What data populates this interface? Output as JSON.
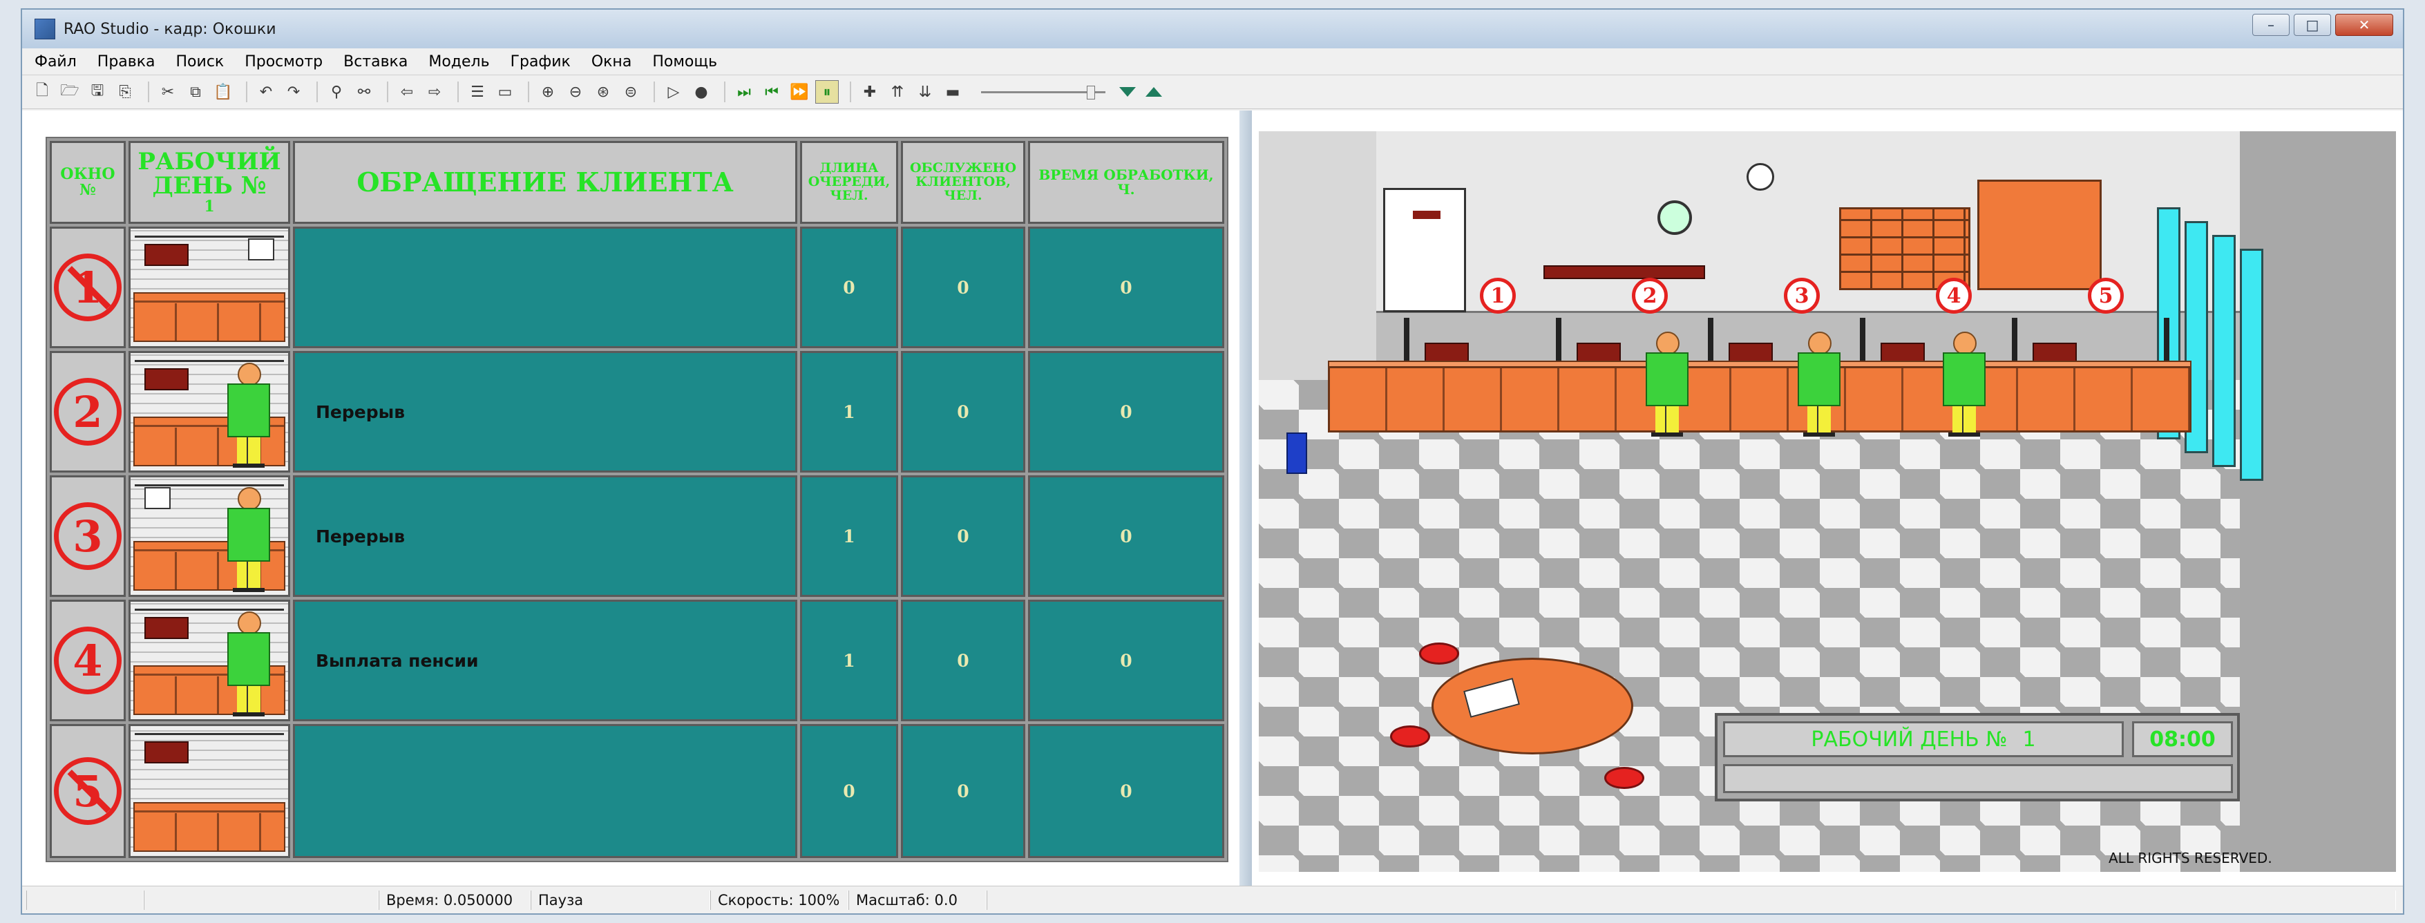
{
  "window": {
    "title": "RAO Studio - кадр: Окошки",
    "buttons": {
      "minimize": "–",
      "maximize": "□",
      "close": "✕"
    }
  },
  "menu": [
    "Файл",
    "Правка",
    "Поиск",
    "Просмотр",
    "Вставка",
    "Модель",
    "График",
    "Окна",
    "Помощь"
  ],
  "toolbar": {
    "icons": [
      "new-file-icon",
      "open-icon",
      "save-icon",
      "save-all-icon",
      "cut-icon",
      "copy-icon",
      "paste-icon",
      "undo-icon",
      "redo-icon",
      "find-icon",
      "replace-icon",
      "back-icon",
      "forward-icon",
      "list-icon",
      "report-icon",
      "zoom-in-icon",
      "zoom-out-icon",
      "zoom-fit-icon",
      "zoom-auto-icon",
      "run-icon",
      "record-icon",
      "step-icon",
      "step-back-icon",
      "fast-forward-icon",
      "pause-icon",
      "plus-icon",
      "speed-up-icon",
      "speed-down-icon",
      "minus-icon",
      "speed-slider",
      "arrow-down-icon",
      "arrow-up-icon"
    ],
    "speed_fraction": 0.9
  },
  "table": {
    "headers": {
      "window_no": "ОКНО №",
      "workday": "РАБОЧИЙ ДЕНЬ №",
      "workday_value": "1",
      "request": "ОБРАЩЕНИЕ КЛИЕНТА",
      "queue": "ДЛИНА ОЧЕРЕДИ, ЧЕЛ.",
      "served": "ОБСЛУЖЕНО КЛИЕНТОВ, ЧЕЛ.",
      "time": "ВРЕМЯ ОБРАБОТКИ, Ч."
    },
    "rows": [
      {
        "number": "1",
        "closed": true,
        "client_present": false,
        "request": "",
        "queue": "0",
        "served": "0",
        "time": "0"
      },
      {
        "number": "2",
        "closed": false,
        "client_present": true,
        "request": "Перерыв",
        "queue": "1",
        "served": "0",
        "time": "0"
      },
      {
        "number": "3",
        "closed": false,
        "client_present": true,
        "request": "Перерыв",
        "queue": "1",
        "served": "0",
        "time": "0"
      },
      {
        "number": "4",
        "closed": false,
        "client_present": true,
        "request": "Выплата пенсии",
        "queue": "1",
        "served": "0",
        "time": "0"
      },
      {
        "number": "5",
        "closed": true,
        "client_present": false,
        "request": "",
        "queue": "0",
        "served": "0",
        "time": "0"
      }
    ]
  },
  "scene": {
    "window_numbers": [
      "1",
      "2",
      "3",
      "4",
      "5"
    ],
    "panel": {
      "workday_label": "РАБОЧИЙ ДЕНЬ №",
      "workday_value": "1",
      "time": "08:00"
    },
    "copyright": "ALL RIGHTS RESERVED.",
    "colors": {
      "counter": "#f07a3a",
      "teal": "#1c8a8a",
      "red": "#e52220",
      "green_text": "#27e327"
    }
  },
  "status": {
    "time": "Время: 0.050000",
    "state": "Пауза",
    "speed": "Скорость: 100%",
    "scale": "Масштаб: 0.0"
  }
}
